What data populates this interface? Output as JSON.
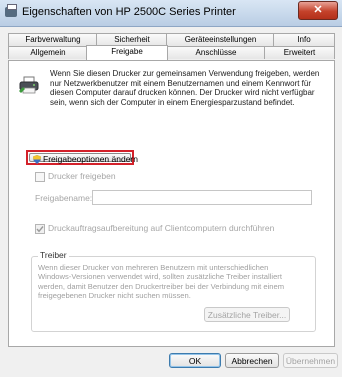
{
  "window": {
    "title": "Eigenschaften von HP 2500C Series Printer",
    "close_label": "✕"
  },
  "tabs": {
    "row1": [
      "Farbverwaltung",
      "Sicherheit",
      "Geräteeinstellungen",
      "Info"
    ],
    "row2": [
      "Allgemein",
      "Freigabe",
      "Anschlüsse",
      "Erweitert"
    ],
    "active": "Freigabe"
  },
  "sharing": {
    "description": "Wenn Sie diesen Drucker zur gemeinsamen Verwendung freigeben, werden nur Netzwerkbenutzer mit einem Benutzernamen und einem Kennwort für diesen Computer darauf drucken können. Der Drucker wird nicht verfügbar sein, wenn sich der Computer in einem Energiesparzustand befindet.",
    "change_options_button": "Freigabeoptionen ändern",
    "share_printer_label": "Drucker freigeben",
    "share_name_label": "Freigabename:",
    "share_name_value": "",
    "render_jobs_label": "Druckauftragsaufbereitung auf Clientcomputern durchführen",
    "render_jobs_checked": true
  },
  "drivers": {
    "group_label": "Treiber",
    "description": "Wenn dieser Drucker von mehreren Benutzern mit unterschiedlichen Windows-Versionen verwendet wird, sollten zusätzliche Treiber installiert werden, damit Benutzer den Druckertreiber bei der Verbindung mit einem freigegebenen Drucker nicht suchen müssen.",
    "additional_drivers_button": "Zusätzliche Treiber..."
  },
  "footer": {
    "ok": "OK",
    "cancel": "Abbrechen",
    "apply": "Übernehmen"
  }
}
